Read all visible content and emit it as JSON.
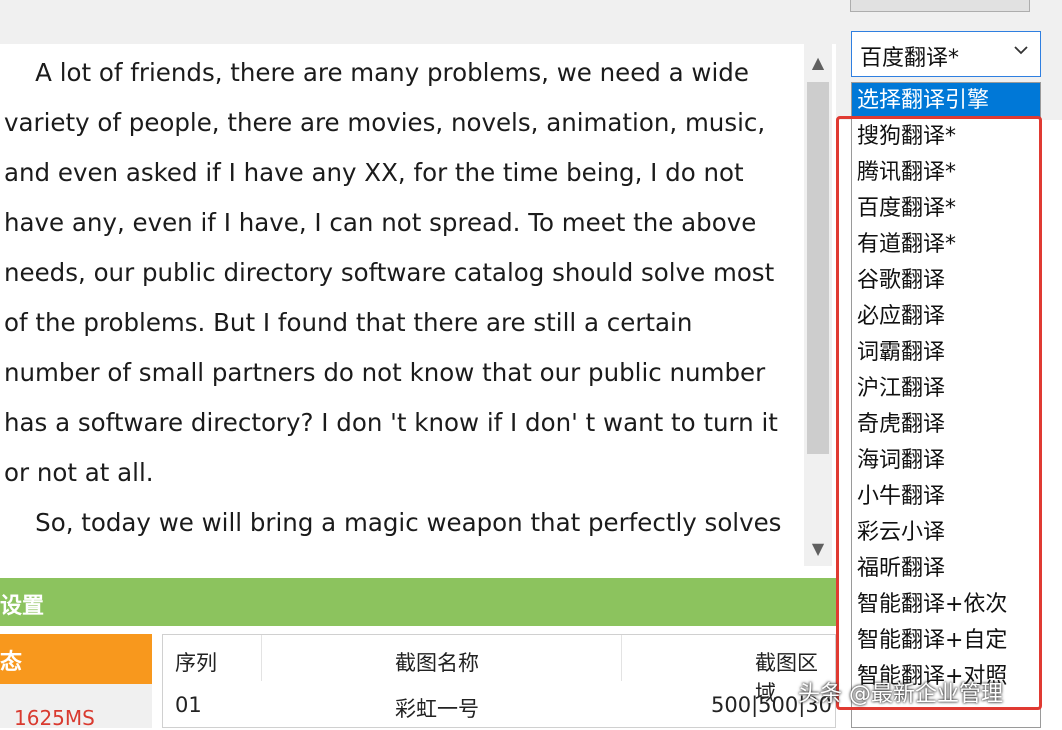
{
  "editor": {
    "paragraph1_lines": [
      "    A lot of friends, there are many problems, we need a wide",
      "variety of people, there are movies, novels, animation, music,",
      "and even asked if I have any XX, for the time being, I do not",
      "have any, even if I have, I can not spread. To meet the above",
      "needs, our public directory software catalog should solve most",
      "of the problems. But I found that there are still a certain",
      "number of small partners do not know that our public number",
      "has a software directory? I don 't know if I don' t want to turn it",
      "or not at all."
    ],
    "paragraph2_lines": [
      "    So, today we will bring a magic weapon that perfectly solves"
    ]
  },
  "scrollbar": {
    "up_icon": "▲",
    "down_icon": "▼"
  },
  "settings": {
    "label": "设置"
  },
  "status": {
    "header": "态",
    "value": "1625MS"
  },
  "table": {
    "headers": [
      "序列",
      "截图名称",
      "截图区域"
    ],
    "rows": [
      [
        "01",
        "彩虹一号",
        "500|500|30"
      ]
    ]
  },
  "translate_select": {
    "selected": "百度翻译*",
    "chevron_icon": "chevron-down"
  },
  "dropdown": {
    "items": [
      "选择翻译引擎",
      "搜狗翻译*",
      "腾讯翻译*",
      "百度翻译*",
      "有道翻译*",
      "谷歌翻译",
      "必应翻译",
      "词霸翻译",
      "沪江翻译",
      "奇虎翻译",
      "海词翻译",
      "小牛翻译",
      "彩云小译",
      "福昕翻译",
      "智能翻译+依次",
      "智能翻译+自定",
      "智能翻译+对照"
    ],
    "selected_index": 0
  },
  "watermark": "头条 @最新企业管理"
}
